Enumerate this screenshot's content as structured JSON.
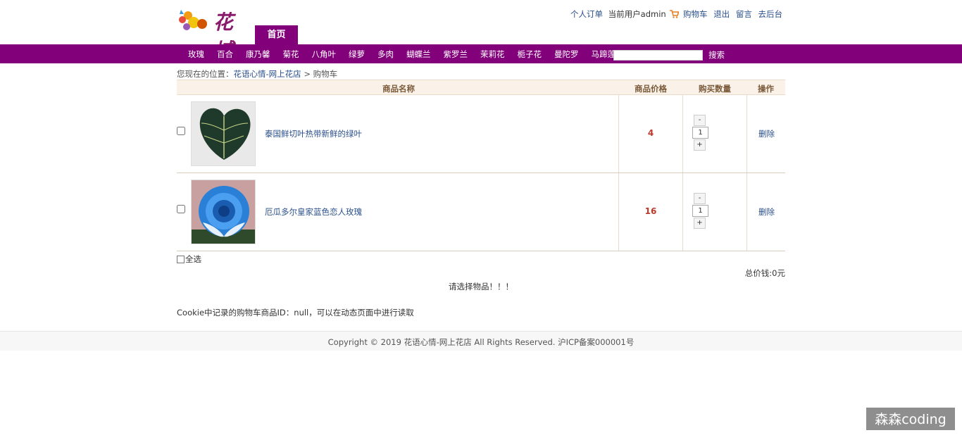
{
  "header": {
    "logo_text": "花城",
    "home_tab": "首页",
    "links": {
      "orders": "个人订单",
      "current_user": "当前用户admin",
      "cart": "购物车",
      "logout": "退出",
      "message": "留言",
      "admin": "去后台"
    }
  },
  "nav": {
    "items": [
      "玫瑰",
      "百合",
      "康乃馨",
      "菊花",
      "八角叶",
      "绿萝",
      "多肉",
      "蝴蝶兰",
      "紫罗兰",
      "茉莉花",
      "栀子花",
      "曼陀罗",
      "马蹄莲"
    ],
    "search_placeholder": "",
    "search_label": "搜索"
  },
  "breadcrumb": {
    "prefix": "您现在的位置：",
    "home": "花语心情-网上花店",
    "sep": ">",
    "current": "购物车"
  },
  "cart": {
    "columns": [
      "商品名称",
      "商品价格",
      "购买数量",
      "操作"
    ],
    "rows": [
      {
        "name": "泰国鲜切叶热带新鲜的绿叶",
        "price": "4",
        "qty": "1",
        "delete": "删除",
        "minus": "-",
        "plus": "+"
      },
      {
        "name": "厄瓜多尔皇家蓝色恋人玫瑰",
        "price": "16",
        "qty": "1",
        "delete": "删除",
        "minus": "-",
        "plus": "+"
      }
    ],
    "select_all": "全选",
    "total": "总价钱:0元",
    "notice": "请选择物品！！！",
    "cookie_note": "Cookie中记录的购物车商品ID：null，可以在动态页面中进行读取"
  },
  "footer": {
    "copyright": "Copyright © 2019 花语心情-网上花店 All Rights Reserved. 沪ICP备案000001号"
  },
  "watermark": "森森coding",
  "colors": {
    "brand": "#83007b",
    "link": "#2a4f8a",
    "price": "#c0392b"
  }
}
